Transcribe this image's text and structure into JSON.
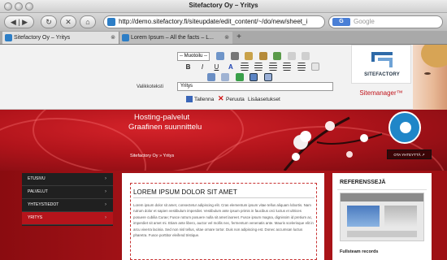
{
  "window": {
    "title": "Sitefactory Oy – Yritys"
  },
  "toolbar": {
    "url": "http://demo.sitefactory.fi/siteupdate/edit_content/~/do/new/sheet_i",
    "search_placeholder": "Google",
    "search_engine_label": "G"
  },
  "tabs": [
    {
      "label": "Sitefactory Oy – Yritys"
    },
    {
      "label": "Lorem Ipsum – All the facts – L..."
    }
  ],
  "editor": {
    "style_select_value": "-- Muotoilu --",
    "format_bold": "B",
    "format_italic": "I",
    "format_underline": "U",
    "format_color": "A",
    "link_text_label": "Valikkoteksti",
    "link_text_value": "Yritys",
    "save_label": "Tallenna",
    "cancel_label": "Peruuta",
    "properties_label": "Lisäasetukset"
  },
  "brand": {
    "logo_name": "SITEFACTORY",
    "product_name": "Sitemanager™",
    "accent_color": "#c0141b"
  },
  "site": {
    "hero_line1": "Hosting-palvelut",
    "hero_line2": "Graafinen suunnittelu",
    "breadcrumb": "Sitefactory Oy » Yritys",
    "contact_button": "OTA YHTEYTTÄ ↗",
    "nav_items": [
      "ETUSIVU",
      "PALVELUT",
      "YHTEYSTIEDOT",
      "YRITYS"
    ],
    "article_title": "LOREM IPSUM DOLOR SIT AMET",
    "article_body": "Lorem ipsum dolor sit amet, consectetur adipiscing elit. Cras elementum ipsum vitae tellus aliquam lobortis. Nam rutrum dolor et sapien vestibulum imperdiet. Vestibulum ante ipsum primis in faucibus orci luctus et ultrices posuere cubilia Curae; Fusce rutrum posuere nulla sit amet laoreet. Fusce ipsum magna, dignissim id pretium ac, imperdiet sit amet mi. Etiam ante libero, auctor vel mollis nec, fermentum venenatis ante. Mauris scelerisque elit in arcu viverra lacinia. Sed non nisl tellus, vitae ornare tortor. Duis non adipiscing est. Donec accumsan luctus pharetra. Fusce porttitor eleifend tristique.",
    "references_heading": "REFERENSSEJÄ",
    "reference_caption": "Fullsteam records"
  }
}
